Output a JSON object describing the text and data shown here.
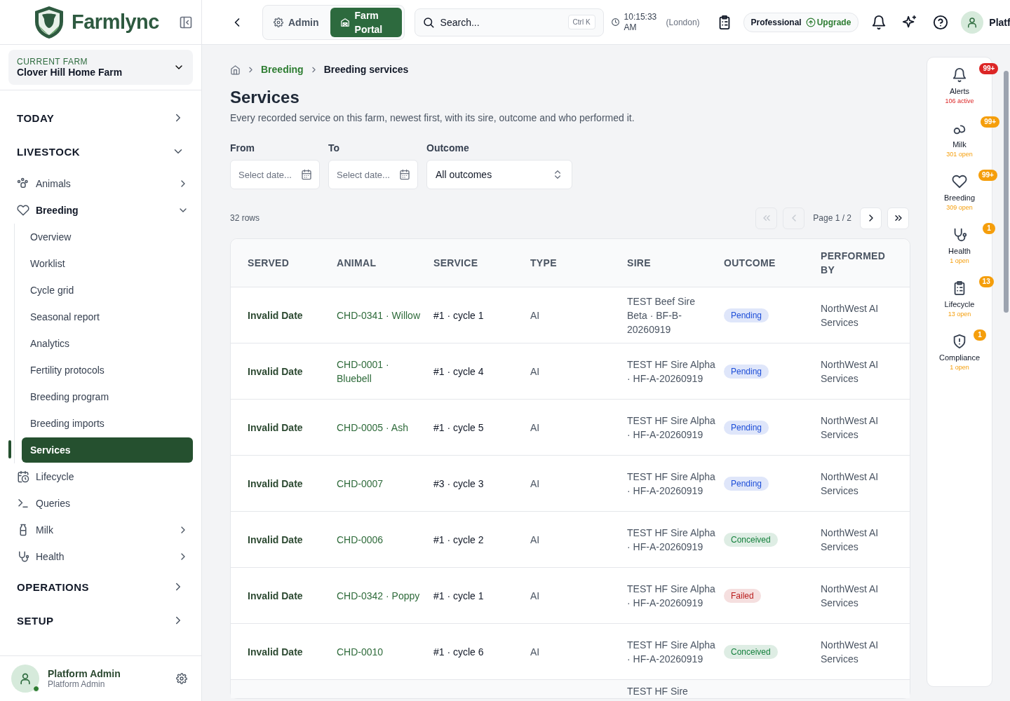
{
  "brand": {
    "name": "Farmlync"
  },
  "portal_tabs": [
    {
      "label": "Admin",
      "selected": false
    },
    {
      "label": "Farm Portal",
      "selected": true
    }
  ],
  "search": {
    "placeholder": "Search...",
    "shortcut": "Ctrl K"
  },
  "clock": {
    "time": "10:15:33 AM",
    "zone": "(London)"
  },
  "plan": {
    "name": "Professional",
    "upgrade": "Upgrade"
  },
  "user_menu": {
    "name": "Platf"
  },
  "farm_selector": {
    "caption": "CURRENT FARM",
    "value": "Clover Hill Home Farm"
  },
  "sidebar": {
    "nav": [
      {
        "kind": "section",
        "label": "TODAY",
        "expanded": false
      },
      {
        "kind": "section",
        "label": "LIVESTOCK",
        "expanded": true,
        "children": [
          {
            "kind": "group",
            "label": "Animals",
            "expanded": false
          },
          {
            "kind": "group",
            "label": "Breeding",
            "expanded": true,
            "children": [
              {
                "label": "Overview",
                "selected": false
              },
              {
                "label": "Worklist",
                "selected": false
              },
              {
                "label": "Cycle grid",
                "selected": false
              },
              {
                "label": "Seasonal report",
                "selected": false
              },
              {
                "label": "Analytics",
                "selected": false
              },
              {
                "label": "Fertility protocols",
                "selected": false
              },
              {
                "label": "Breeding program",
                "selected": false
              },
              {
                "label": "Breeding imports",
                "selected": false
              },
              {
                "label": "Services",
                "selected": true
              }
            ]
          },
          {
            "kind": "link",
            "label": "Lifecycle"
          },
          {
            "kind": "link",
            "label": "Queries"
          },
          {
            "kind": "group",
            "label": "Milk",
            "expanded": false
          },
          {
            "kind": "group",
            "label": "Health",
            "expanded": false
          }
        ]
      },
      {
        "kind": "section",
        "label": "OPERATIONS",
        "expanded": false
      },
      {
        "kind": "section",
        "label": "SETUP",
        "expanded": false
      }
    ]
  },
  "sidebar_user": {
    "name": "Platform Admin",
    "role": "Platform Admin",
    "online": true
  },
  "breadcrumbs": [
    {
      "label": "Breeding",
      "kind": "link"
    },
    {
      "label": "Breeding services",
      "kind": "current"
    }
  ],
  "page": {
    "title": "Services",
    "description": "Every recorded service on this farm, newest first, with its sire, outcome and who performed it."
  },
  "filters": [
    {
      "kind": "date",
      "label": "From",
      "placeholder": "Select date..."
    },
    {
      "kind": "date",
      "label": "To",
      "placeholder": "Select date..."
    },
    {
      "kind": "select",
      "label": "Outcome",
      "value": "All outcomes"
    }
  ],
  "table": {
    "row_count": "32 rows",
    "page_label": "Page 1 / 2",
    "pager_buttons": [
      {
        "kind": "first",
        "disabled": true
      },
      {
        "kind": "prev",
        "disabled": true
      },
      {
        "kind": "next",
        "disabled": false
      },
      {
        "kind": "last",
        "disabled": false
      }
    ],
    "columns": [
      "SERVED",
      "ANIMAL",
      "SERVICE",
      "TYPE",
      "SIRE",
      "OUTCOME",
      "PERFORMED BY"
    ],
    "rows": [
      {
        "served": "Invalid Date",
        "animal": "CHD-0341 · Willow",
        "service": "#1 · cycle 1",
        "type": "AI",
        "sire": "TEST Beef Sire Beta · BF-B-20260919",
        "outcome": "Pending",
        "color": "#1d4ed8",
        "performed_by": "NorthWest AI Services"
      },
      {
        "served": "Invalid Date",
        "animal": "CHD-0001 · Bluebell",
        "service": "#1 · cycle 4",
        "type": "AI",
        "sire": "TEST HF Sire Alpha · HF-A-20260919",
        "outcome": "Pending",
        "color": "#1d4ed8",
        "performed_by": "NorthWest AI Services"
      },
      {
        "served": "Invalid Date",
        "animal": "CHD-0005 · Ash",
        "service": "#1 · cycle 5",
        "type": "AI",
        "sire": "TEST HF Sire Alpha · HF-A-20260919",
        "outcome": "Pending",
        "color": "#1d4ed8",
        "performed_by": "NorthWest AI Services"
      },
      {
        "served": "Invalid Date",
        "animal": "CHD-0007",
        "service": "#3 · cycle 3",
        "type": "AI",
        "sire": "TEST HF Sire Alpha · HF-A-20260919",
        "outcome": "Pending",
        "color": "#1d4ed8",
        "performed_by": "NorthWest AI Services"
      },
      {
        "served": "Invalid Date",
        "animal": "CHD-0006",
        "service": "#1 · cycle 2",
        "type": "AI",
        "sire": "TEST HF Sire Alpha · HF-A-20260919",
        "outcome": "Conceived",
        "color": "#15803d",
        "performed_by": "NorthWest AI Services"
      },
      {
        "served": "Invalid Date",
        "animal": "CHD-0342 · Poppy",
        "service": "#1 · cycle 1",
        "type": "AI",
        "sire": "TEST HF Sire Alpha · HF-A-20260919",
        "outcome": "Failed",
        "color": "#b91c1c",
        "performed_by": "NorthWest AI Services"
      },
      {
        "served": "Invalid Date",
        "animal": "CHD-0010",
        "service": "#1 · cycle 6",
        "type": "AI",
        "sire": "TEST HF Sire Alpha · HF-A-20260919",
        "outcome": "Conceived",
        "color": "#15803d",
        "performed_by": "NorthWest AI Services"
      },
      {
        "sire": "TEST HF Sire"
      }
    ]
  },
  "rail": [
    {
      "label": "Alerts",
      "badge": "99+",
      "status": "106 active",
      "color": "#dc2626"
    },
    {
      "label": "Milk",
      "badge": "99+",
      "status": "301 open",
      "color": "#f59e0b"
    },
    {
      "label": "Breeding",
      "badge": "99+",
      "status": "309 open",
      "color": "#f59e0b"
    },
    {
      "label": "Health",
      "badge": "1",
      "status": "1 open",
      "color": "#f59e0b"
    },
    {
      "label": "Lifecycle",
      "badge": "13",
      "status": "13 open",
      "color": "#f59e0b"
    },
    {
      "label": "Compliance",
      "badge": "1",
      "status": "1 open",
      "color": "#f59e0b"
    }
  ]
}
